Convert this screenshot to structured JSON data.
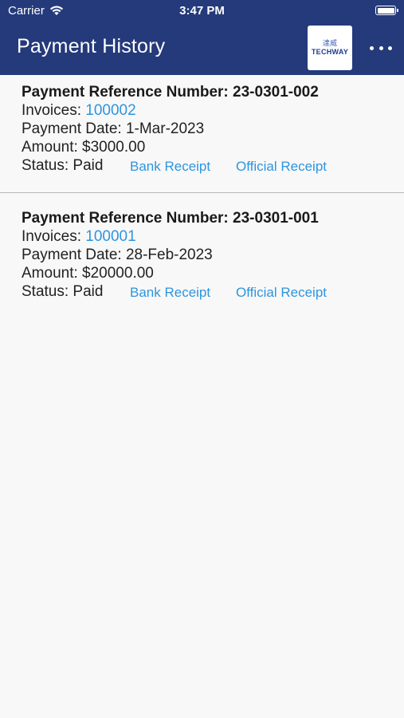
{
  "status_bar": {
    "carrier": "Carrier",
    "time": "3:47 PM"
  },
  "header": {
    "title": "Payment History",
    "logo_text": "TECHWAY",
    "logo_chinese": "達威",
    "bg_color": "#243a7b"
  },
  "payments": [
    {
      "reference_label": "Payment Reference Number: 23-0301-002",
      "invoices_label": "Invoices: ",
      "invoice": "100002",
      "date_label": "Payment Date: 1-Mar-2023",
      "amount_label": "Amount: $3000.00",
      "status_label": "Status: Paid",
      "bank_receipt": "Bank Receipt",
      "official_receipt": "Official Receipt"
    },
    {
      "reference_label": "Payment Reference Number: 23-0301-001",
      "invoices_label": "Invoices: ",
      "invoice": "100001",
      "date_label": "Payment Date: 28-Feb-2023",
      "amount_label": "Amount: $20000.00",
      "status_label": "Status: Paid",
      "bank_receipt": "Bank Receipt",
      "official_receipt": "Official Receipt"
    }
  ],
  "link_color": "#2d95df"
}
